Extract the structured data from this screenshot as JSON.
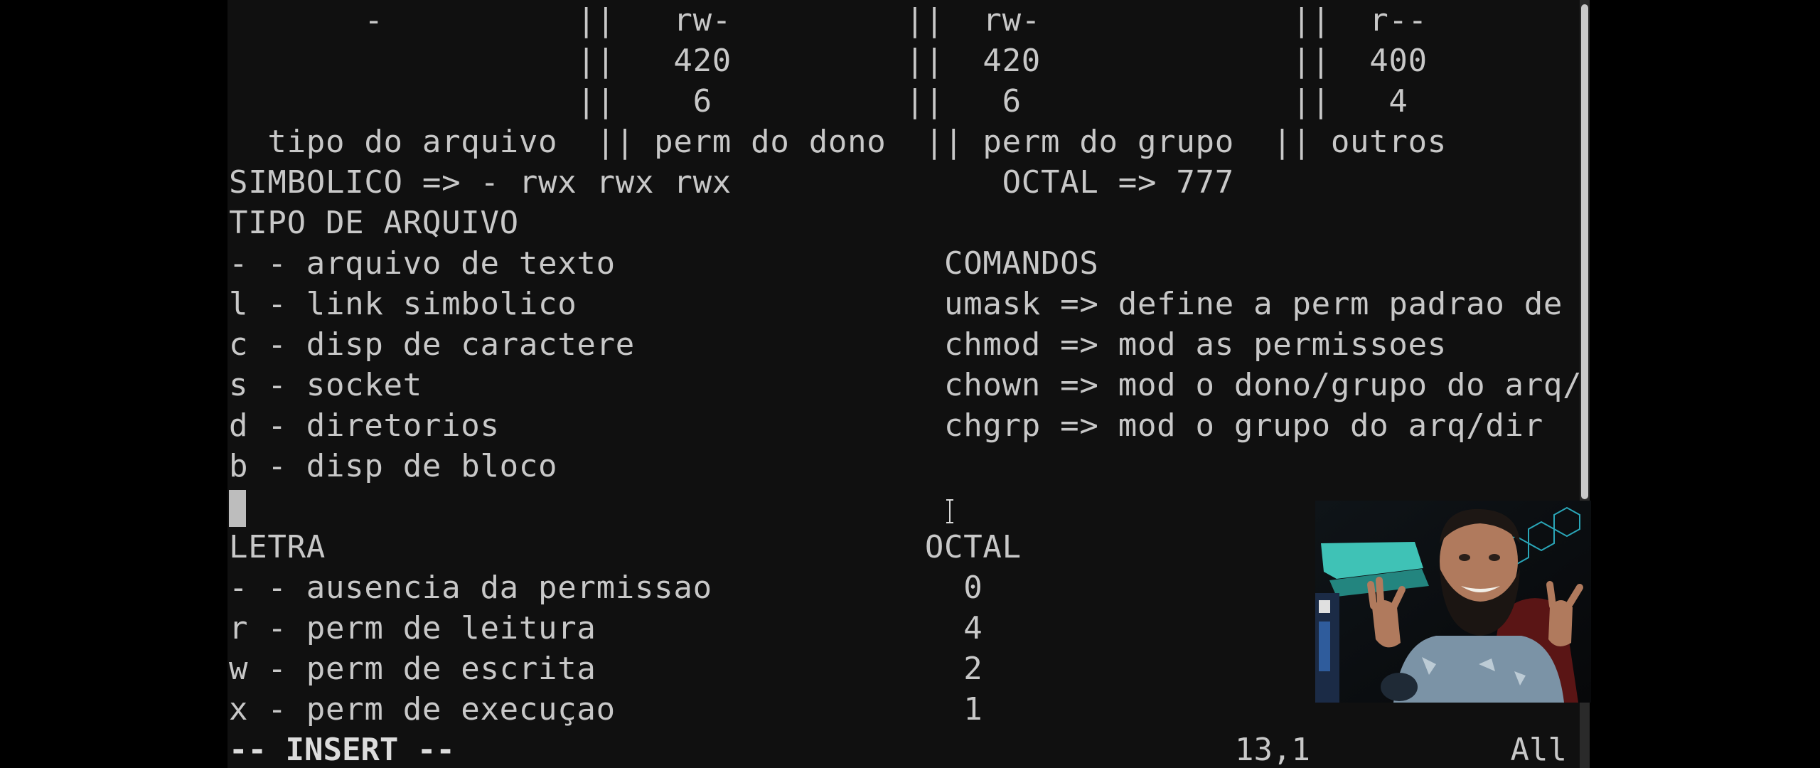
{
  "editor": {
    "lines": [
      "       -          ||   rw-         ||  rw-             ||  r--",
      "                  ||   420         ||  420             ||  400",
      "                  ||    6          ||   6              ||   4",
      "  tipo do arquivo  || perm do dono  || perm do grupo  || outros",
      "SIMBOLICO => - rwx rwx rwx              OCTAL => 777",
      "TIPO DE ARQUIVO",
      "- - arquivo de texto                 COMANDOS",
      "l - link simbolico                   umask => define a perm padrao de arq",
      "c - disp de caractere                chmod => mod as permissoes",
      "s - socket                           chown => mod o dono/grupo do arq/dir",
      "d - diretorios                       chgrp => mod o grupo do arq/dir",
      "b - disp de bloco",
      "",
      "LETRA                               OCTAL",
      "- - ausencia da permissao             0",
      "r - perm de leitura                   4",
      "w - perm de escrita                   2",
      "x - perm de execuçao                  1"
    ]
  },
  "status": {
    "mode": "-- INSERT --",
    "position": "13,1",
    "scroll": "All"
  },
  "icons": {
    "text_cursor": "i-beam-cursor-icon"
  },
  "colors": {
    "background": "#101010",
    "text": "#c8c8c8",
    "cursor": "#bdbdbd"
  }
}
